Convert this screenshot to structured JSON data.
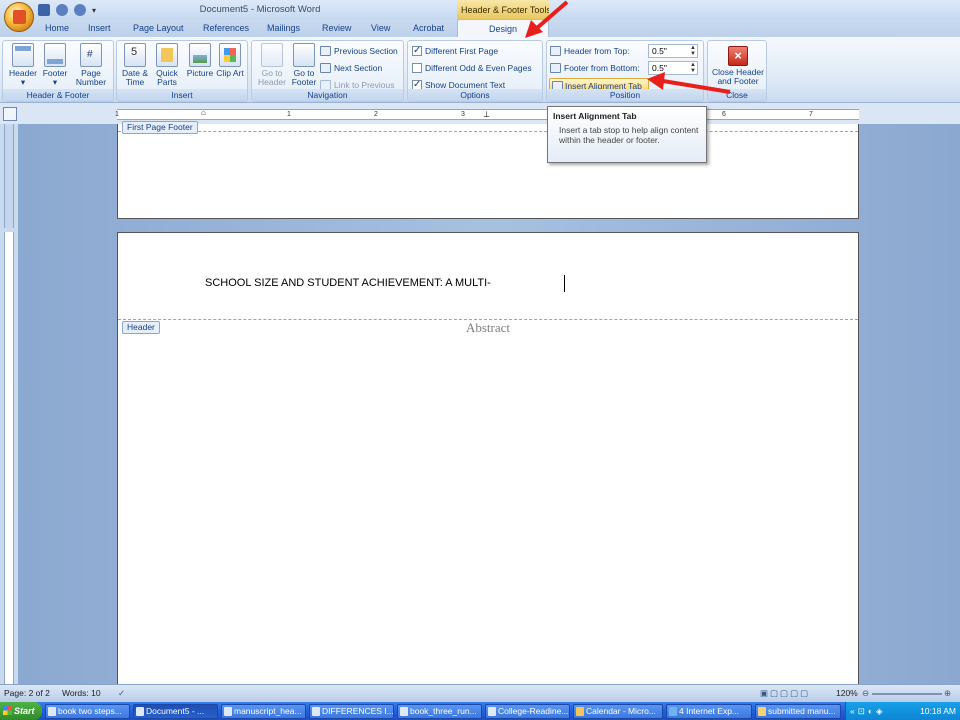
{
  "app": {
    "title": "Document5 - Microsoft Word",
    "context_tab_group": "Header & Footer Tools"
  },
  "tabs": [
    "Home",
    "Insert",
    "Page Layout",
    "References",
    "Mailings",
    "Review",
    "View",
    "Acrobat"
  ],
  "active_tab": "Design",
  "ribbon": {
    "header_footer": {
      "label": "Header & Footer",
      "header": "Header",
      "footer": "Footer",
      "page_number": "Page Number"
    },
    "insert": {
      "label": "Insert",
      "date_time": "Date & Time",
      "quick_parts": "Quick Parts",
      "picture": "Picture",
      "clip_art": "Clip Art"
    },
    "navigation": {
      "label": "Navigation",
      "go_to_header": "Go to Header",
      "go_to_footer": "Go to Footer",
      "previous_section": "Previous Section",
      "next_section": "Next Section",
      "link_to_previous": "Link to Previous"
    },
    "options": {
      "label": "Options",
      "different_first_page": "Different First Page",
      "different_odd_even": "Different Odd & Even Pages",
      "show_document_text": "Show Document Text",
      "checked": [
        true,
        false,
        true
      ]
    },
    "position": {
      "label": "Position",
      "header_from_top": "Header from Top:",
      "header_from_top_value": "0.5\"",
      "footer_from_bottom": "Footer from Bottom:",
      "footer_from_bottom_value": "0.5\"",
      "insert_alignment_tab": "Insert Alignment Tab"
    },
    "close": {
      "label": "Close",
      "close_button": "Close Header and Footer"
    }
  },
  "tooltip": {
    "title": "Insert Alignment Tab",
    "body": "Insert a tab stop to help align content within the header or footer."
  },
  "ruler": {
    "numbers": [
      "1",
      "1",
      "2",
      "3",
      "4",
      "5",
      "6",
      "7"
    ]
  },
  "document": {
    "first_page_footer_label": "First Page Footer",
    "header_label": "Header",
    "running_head": "SCHOOL SIZE AND STUDENT ACHIEVEMENT: A MULTI-",
    "body_heading": "Abstract"
  },
  "status": {
    "page": "Page: 2 of 2",
    "words": "Words: 10",
    "zoom": "120%"
  },
  "taskbar": {
    "start": "Start",
    "items": [
      "book two steps...",
      "Document5 - ...",
      "manuscript_hea...",
      "DIFFERENCES I...",
      "book_three_run...",
      "College-Readine...",
      "Calendar - Micro...",
      "4 Internet Exp...",
      "submitted manu..."
    ],
    "clock": "10:18 AM"
  },
  "colors": {
    "accent_arrow": "#e8201c",
    "ribbon_text": "#15428b",
    "contextual_tab": "#f2d46b"
  }
}
